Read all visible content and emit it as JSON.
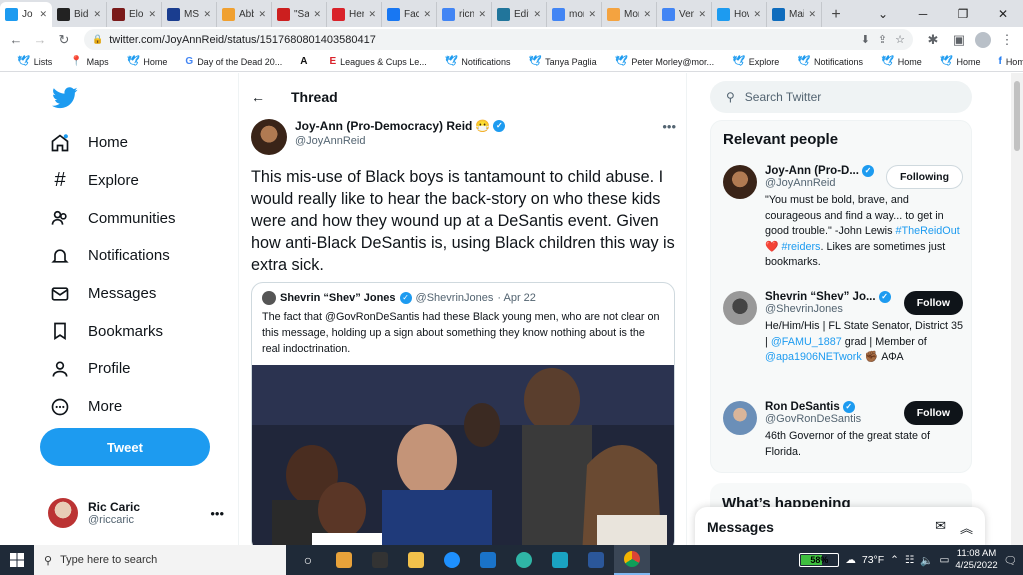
{
  "browser": {
    "tabs": [
      {
        "title": "Jo",
        "icon": "twitter-icon",
        "color": "#1d9bf0",
        "active": true
      },
      {
        "title": "Biden",
        "icon": "t-logo-icon",
        "color": "#222222"
      },
      {
        "title": "Elon M",
        "icon": "news-icon",
        "color": "#7a1a1a"
      },
      {
        "title": "MSNE",
        "icon": "msnbc-icon",
        "color": "#1a3d8f"
      },
      {
        "title": "Abbre",
        "icon": "abbreviation-icon",
        "color": "#f0a030"
      },
      {
        "title": "\"Sand",
        "icon": "red-circle-icon",
        "color": "#cc1f1f"
      },
      {
        "title": "Herbe",
        "icon": "e-logo-icon",
        "color": "#d9222a"
      },
      {
        "title": "Faceb",
        "icon": "facebook-icon",
        "color": "#1877f2"
      },
      {
        "title": "ricnca",
        "icon": "google-icon",
        "color": "#4285f4"
      },
      {
        "title": "Edit P",
        "icon": "wordpress-icon",
        "color": "#21759b"
      },
      {
        "title": "mont",
        "icon": "google-icon",
        "color": "#4285f4"
      },
      {
        "title": "Mont",
        "icon": "bookmark-icon",
        "color": "#f4a340"
      },
      {
        "title": "Venic",
        "icon": "google-icon",
        "color": "#4285f4"
      },
      {
        "title": "How t",
        "icon": "twitter-icon",
        "color": "#1d9bf0"
      },
      {
        "title": "Mail -",
        "icon": "outlook-icon",
        "color": "#0f6cbd"
      }
    ],
    "url": "twitter.com/JoyAnnReid/status/1517680801403580417",
    "bookmarks": [
      {
        "label": "Lists",
        "icon": "twitter-icon"
      },
      {
        "label": "Maps",
        "icon": "maps-icon"
      },
      {
        "label": "Home",
        "icon": "twitter-icon"
      },
      {
        "label": "Day of the Dead 20...",
        "icon": "google-icon"
      },
      {
        "label": "",
        "icon": "a-logo-icon"
      },
      {
        "label": "Leagues & Cups Le...",
        "icon": "e-logo-icon"
      },
      {
        "label": "Notifications",
        "icon": "twitter-icon"
      },
      {
        "label": "Tanya Paglia",
        "icon": "twitter-icon"
      },
      {
        "label": "Peter Morley@mor...",
        "icon": "twitter-icon"
      },
      {
        "label": "Explore",
        "icon": "twitter-icon"
      },
      {
        "label": "Notifications",
        "icon": "twitter-icon"
      },
      {
        "label": "Home",
        "icon": "twitter-icon"
      },
      {
        "label": "Home",
        "icon": "twitter-icon"
      },
      {
        "label": "Home",
        "icon": "facebook-icon"
      }
    ]
  },
  "nav": {
    "items": [
      {
        "label": "Home",
        "icon": "home-icon"
      },
      {
        "label": "Explore",
        "icon": "hashtag-icon"
      },
      {
        "label": "Communities",
        "icon": "communities-icon"
      },
      {
        "label": "Notifications",
        "icon": "bell-icon"
      },
      {
        "label": "Messages",
        "icon": "envelope-icon"
      },
      {
        "label": "Bookmarks",
        "icon": "bookmark-icon"
      },
      {
        "label": "Profile",
        "icon": "person-icon"
      },
      {
        "label": "More",
        "icon": "more-circle-icon"
      }
    ],
    "tweet_button": "Tweet",
    "account": {
      "name": "Ric Caric",
      "handle": "@riccaric"
    }
  },
  "thread": {
    "header": "Thread",
    "author_name": "Joy-Ann (Pro-Democracy) Reid",
    "author_emoji": "😷",
    "author_handle": "@JoyAnnReid",
    "text": "This mis-use of Black boys is tantamount to child abuse. I would really like to hear the back-story on who these kids were and how they wound up at a DeSantis event. Given how anti-Black DeSantis is, using Black children this way is extra sick.",
    "quote": {
      "name": "Shevrin “Shev” Jones",
      "handle": "@ShevrinJones",
      "date": "· Apr 22",
      "text": "The fact that @GovRonDeSantis had these Black young men, who are not clear on this message, holding up a sign about something they know nothing about is the real indoctrination."
    }
  },
  "sidebar": {
    "search_placeholder": "Search Twitter",
    "relevant_title": "Relevant people",
    "people": [
      {
        "name": "Joy-Ann (Pro-D...",
        "handle": "@JoyAnnReid",
        "button": "Following",
        "bio_pre": "\"You must be bold, brave, and courageous and find a way... to get in good trouble.\" -John Lewis ",
        "bio_link1": "#TheReidOut",
        "bio_mid": " ❤️ ",
        "bio_link2": "#reiders",
        "bio_post": ". Likes are sometimes just bookmarks."
      },
      {
        "name": "Shevrin “Shev” Jo...",
        "handle": "@ShevrinJones",
        "button": "Follow",
        "bio_pre": "He/Him/His | FL State Senator, District 35 | ",
        "bio_link1": "@FAMU_1887",
        "bio_mid": " grad | Member of ",
        "bio_link2": "@apa1906NETwork",
        "bio_post": " ✊🏾 ΑΦΑ"
      },
      {
        "name": "Ron DeSantis",
        "handle": "@GovRonDeSantis",
        "button": "Follow",
        "bio_pre": "46th Governor of the great state of Florida.",
        "bio_link1": "",
        "bio_mid": "",
        "bio_link2": "",
        "bio_post": ""
      }
    ],
    "happening_title": "What’s happening",
    "messages_title": "Messages"
  },
  "taskbar": {
    "search_placeholder": "Type here to search",
    "battery": "58%",
    "battery_level": 0.58,
    "weather": "73°F",
    "time": "11:08 AM",
    "date": "4/25/2022"
  }
}
